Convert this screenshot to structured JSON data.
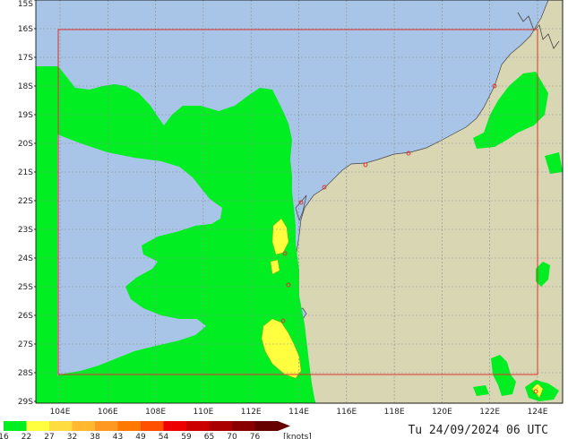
{
  "map": {
    "latitude_labels": [
      "15S",
      "16S",
      "17S",
      "18S",
      "19S",
      "20S",
      "21S",
      "22S",
      "23S",
      "24S",
      "25S",
      "26S",
      "27S",
      "28S",
      "29S"
    ],
    "longitude_labels": [
      "104E",
      "106E",
      "108E",
      "110E",
      "112E",
      "114E",
      "116E",
      "118E",
      "120E",
      "122E",
      "124E"
    ],
    "colors": {
      "ocean": "#a8c4e6",
      "land": "#d9d6b4",
      "grid": "#8c8c8c",
      "domain_box": "#e03030",
      "wind_green": "#00ee22",
      "wind_yellow": "#ffff40",
      "coastline": "#444444"
    }
  },
  "legend": {
    "labels": [
      "16",
      "22",
      "27",
      "32",
      "38",
      "43",
      "49",
      "54",
      "59",
      "65",
      "70",
      "76",
      "[knots]"
    ],
    "colors": [
      "#00ee22",
      "#ffff40",
      "#ffdc40",
      "#ffb830",
      "#ff9820",
      "#ff7800",
      "#ff5000",
      "#ee0000",
      "#cc0000",
      "#aa0000",
      "#880000",
      "#660000"
    ]
  },
  "timestamp": "Tu 24/09/2024 06 UTC"
}
